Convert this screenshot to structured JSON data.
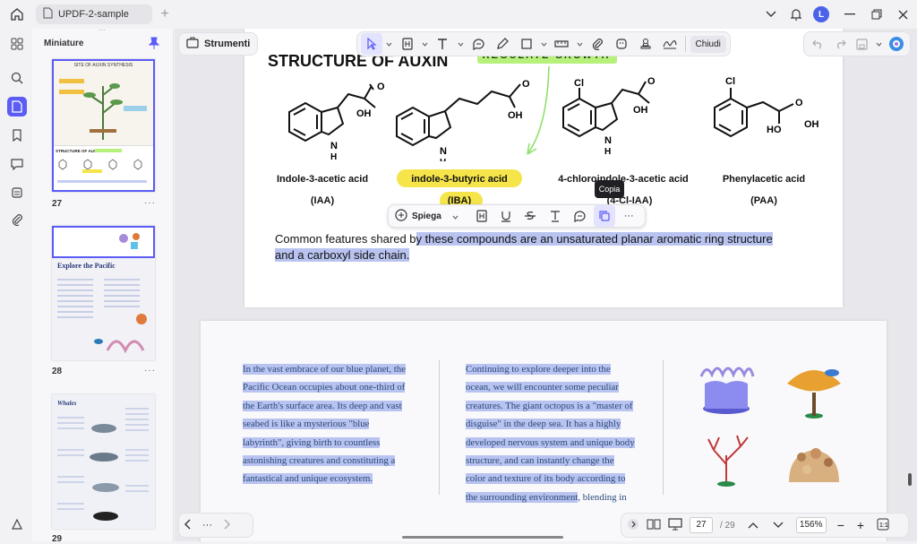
{
  "window": {
    "tab_title": "UPDF-2-sample",
    "avatar_letter": "L",
    "accent": "#5b5bf6"
  },
  "panel": {
    "title": "Miniature",
    "thumbnails": [
      {
        "page": "27",
        "heading": "STRUCTURE OF AUXIN",
        "top_heading": "SITE OF AUXIN SYNTHESIS"
      },
      {
        "page": "28",
        "heading": "Explore the Pacific"
      },
      {
        "page": "29",
        "heading": "Whales"
      }
    ]
  },
  "tools": {
    "label": "Strumenti",
    "close_label": "Chiudi"
  },
  "doc": {
    "title": "STRUCTURE OF AUXIN",
    "banner": "REGULATE GROWTH",
    "molecules": [
      {
        "name": "Indole-3-acetic acid",
        "abbr": "(IAA)"
      },
      {
        "name": "indole-3-butyric acid",
        "abbr": "(IBA)"
      },
      {
        "name": "4-chloroindole-3-acetic acid",
        "abbr": "(4-Cl-IAA)"
      },
      {
        "name": "Phenylacetic acid",
        "abbr": "(PAA)"
      }
    ],
    "sentence_plain": "Common features shared b",
    "sentence_selected_1": "y these compounds are an unsaturated planar aromatic ring structure",
    "sentence_selected_2": "and a carboxyl side chain.",
    "col1": [
      "In the vast embrace of our blue planet, the",
      "Pacific Ocean occupies about one-third of",
      "the Earth's surface area. Its deep and vast",
      "seabed is like a mysterious \"blue",
      "labyrinth\", giving birth to countless",
      "astonishing creatures and constituting a",
      "fantastical and unique ecosystem."
    ],
    "col2": [
      "Continuing to explore deeper into the",
      "ocean, we will encounter some peculiar",
      "creatures. The giant octopus is a \"master of",
      "disguise\" in the deep sea. It has a highly",
      "developed nervous system and unique body",
      "structure, and can instantly change the",
      "color and texture of its body according to",
      "the surrounding environment"
    ],
    "col2_tail": ", blending in"
  },
  "popup": {
    "explain_label": "Spiega",
    "tooltip": "Copia"
  },
  "nav": {
    "current_page": "27",
    "total_pages": "/ 29",
    "zoom": "156%"
  }
}
